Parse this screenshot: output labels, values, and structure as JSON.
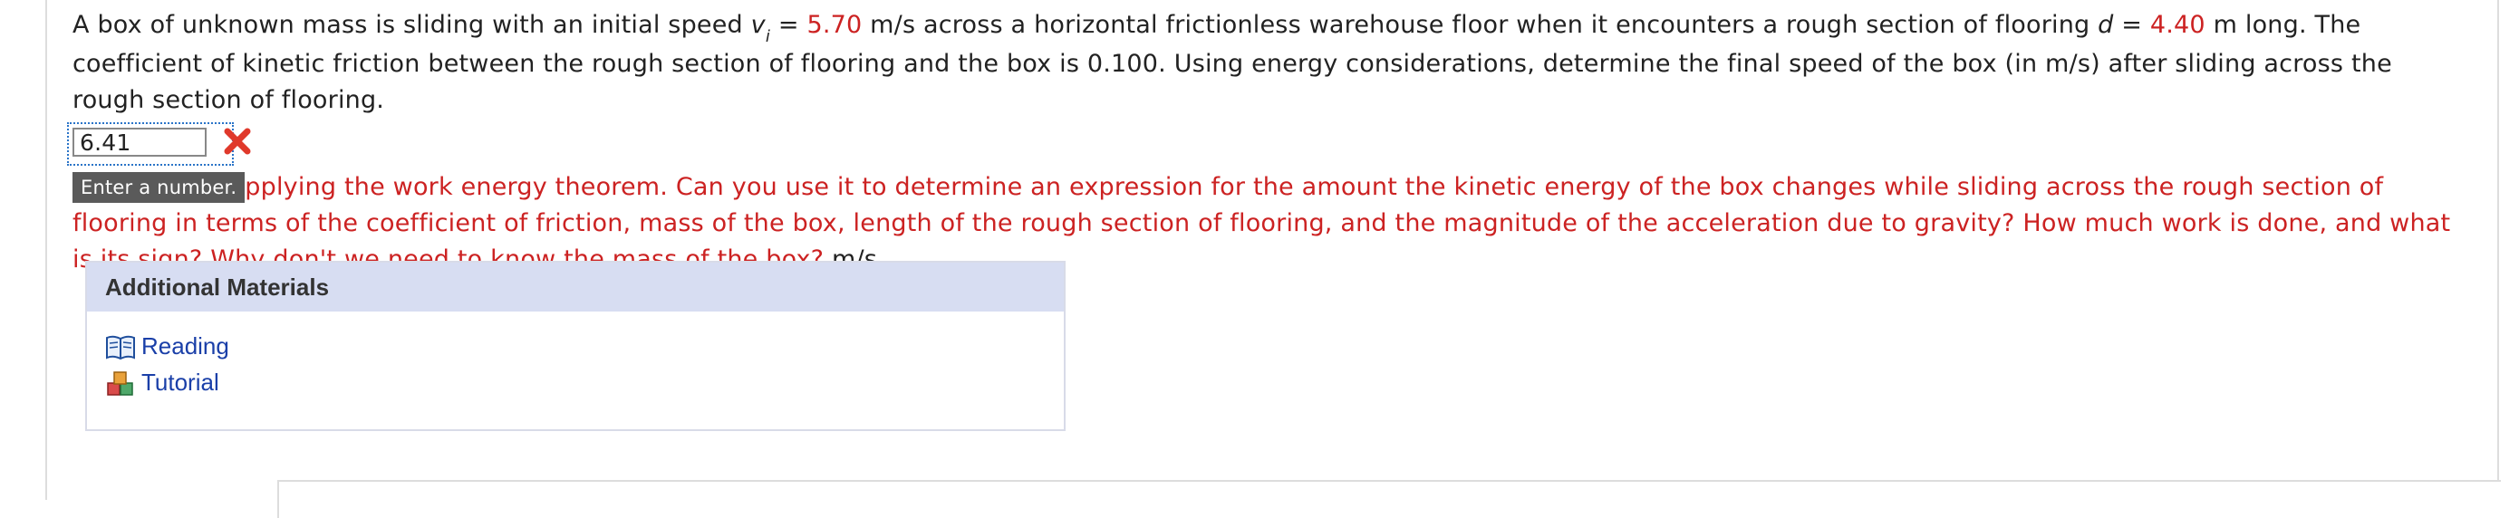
{
  "question": {
    "part1": "A box of unknown mass is sliding with an initial speed ",
    "var_v": "v",
    "var_v_sub": "i",
    "eq1": " = ",
    "v_value": "5.70",
    "part2": " m/s across a horizontal frictionless warehouse floor when it encounters a rough section of flooring ",
    "var_d": "d",
    "eq2": " = ",
    "d_value": "4.40",
    "part3": " m long. The coefficient of kinetic friction between the rough section of flooring and the box is 0.100. Using energy considerations, determine the final speed of the box (in m/s) after sliding across the rough section of flooring."
  },
  "answer": {
    "value": "6.41",
    "status": "incorrect",
    "status_icon": "x-mark-icon",
    "status_color": "#e0392b"
  },
  "tooltip": "Enter a number.",
  "feedback": {
    "text": "pplying the work energy theorem. Can you use it to determine an expression for the amount the kinetic energy of the box changes while sliding across the rough section of flooring in terms of the coefficient of friction, mass of the box, length of the rough section of flooring, and the magnitude of the acceleration due to gravity? How much work is done, and what is its sign? Why don't we need to know the mass of the box?",
    "unit": " m/s",
    "color": "#cc2222"
  },
  "materials": {
    "header": "Additional Materials",
    "items": [
      {
        "label": "Reading",
        "icon": "book-icon"
      },
      {
        "label": "Tutorial",
        "icon": "cubes-icon"
      }
    ]
  }
}
